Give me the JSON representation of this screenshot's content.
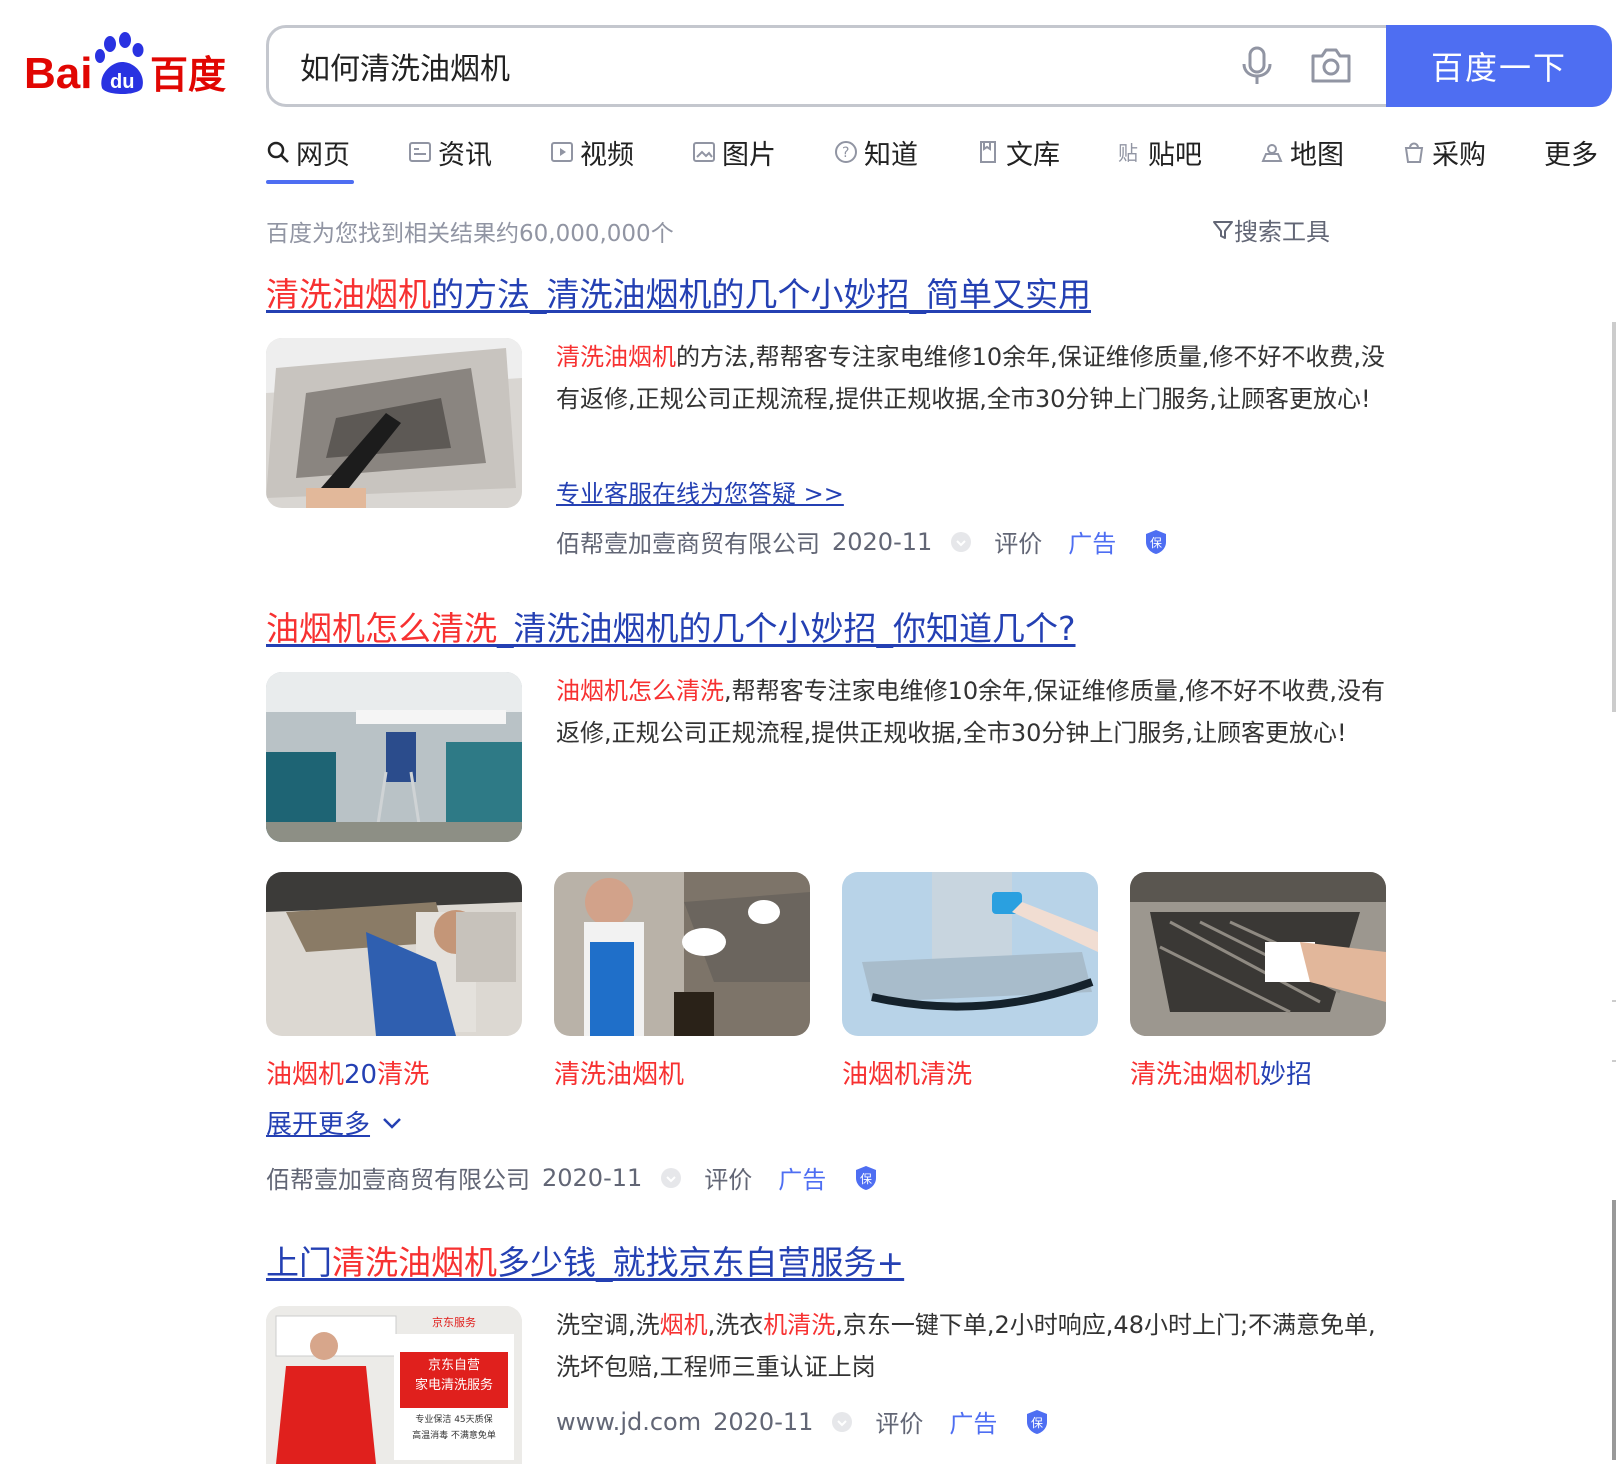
{
  "header": {
    "logo_text_latin": "Bai",
    "logo_text_du": "du",
    "logo_text_cn": "百度",
    "query": "如何清洗油烟机",
    "search_button_label": "百度一下",
    "mic_icon": "microphone-icon",
    "camera_icon": "camera-icon"
  },
  "tabs": [
    {
      "label": "网页",
      "icon": "search-icon",
      "active": true
    },
    {
      "label": "资讯",
      "icon": "news-icon"
    },
    {
      "label": "视频",
      "icon": "video-icon"
    },
    {
      "label": "图片",
      "icon": "image-icon"
    },
    {
      "label": "知道",
      "icon": "question-icon"
    },
    {
      "label": "文库",
      "icon": "document-icon"
    },
    {
      "label": "贴吧",
      "icon": "tieba-icon"
    },
    {
      "label": "地图",
      "icon": "map-icon"
    },
    {
      "label": "采购",
      "icon": "shopping-icon"
    },
    {
      "label": "更多"
    }
  ],
  "summary": {
    "result_count": "百度为您找到相关结果约60,000,000个",
    "search_tools": "搜索工具"
  },
  "results": [
    {
      "title_hl": "清洗油烟机",
      "title_rest": "的方法_清洗油烟机的几个小妙招_简单又实用",
      "desc_hl": "清洗油烟机",
      "desc_rest": "的方法,帮帮客专注家电维修10余年,保证维修质量,修不好不收费,没有返修,正规公司正规流程,提供正规收据,全市30分钟上门服务,让顾客更放心!",
      "more_link": "专业客服在线为您答疑 >>",
      "source": "佰帮壹加壹商贸有限公司",
      "date": "2020-11",
      "rate": "评价",
      "ad": "广告"
    },
    {
      "title_hl": "油烟机怎么清洗",
      "title_rest": "_清洗油烟机的几个小妙招_你知道几个?",
      "desc_hl": "油烟机怎么清洗",
      "desc_rest": ",帮帮客专注家电维修10余年,保证维修质量,修不好不收费,没有返修,正规公司正规流程,提供正规收据,全市30分钟上门服务,让顾客更放心!",
      "gallery": [
        {
          "red": "油烟机",
          "blue": "20",
          "red2": "清洗"
        },
        {
          "red": "清洗油烟机",
          "blue": "",
          "red2": ""
        },
        {
          "red": "油烟机清洗",
          "blue": "",
          "red2": ""
        },
        {
          "red": "清洗油烟机",
          "blue": "妙招",
          "red2": ""
        }
      ],
      "expand": "展开更多",
      "source": "佰帮壹加壹商贸有限公司",
      "date": "2020-11",
      "rate": "评价",
      "ad": "广告"
    },
    {
      "title_pre": "上门",
      "title_hl": "清洗油烟机",
      "title_rest": "多少钱_就找京东自营服务+",
      "desc_parts": [
        "洗空调,洗",
        "烟机",
        ",洗衣",
        "机清洗",
        ",京东一键下单,2小时响应,48小时上门;不满意免单,洗坏包赔,工程师三重认证上岗"
      ],
      "thumb_text": [
        "京东自营",
        "家电清洗服务",
        "专业保洁 45天质保",
        "高温消毒 不满意免单"
      ],
      "source": "www.jd.com",
      "date": "2020-11",
      "rate": "评价",
      "ad": "广告"
    }
  ],
  "colors": {
    "brand_blue": "#4e6ef2",
    "link_blue": "#2440b3",
    "highlight_red": "#f73131",
    "muted_gray": "#626675",
    "logo_red": "#e10602"
  }
}
